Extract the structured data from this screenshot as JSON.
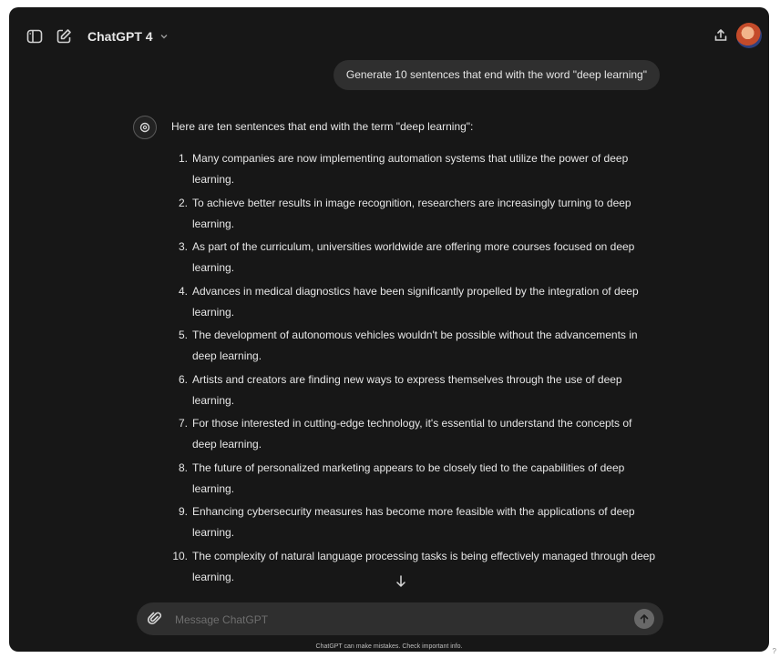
{
  "header": {
    "model_name": "ChatGPT 4",
    "icons": [
      "sidebar-toggle-icon",
      "new-chat-icon",
      "chevron-down-icon",
      "share-icon"
    ]
  },
  "conversation": {
    "user_message": "Generate 10 sentences that end with the word \"deep learning\"",
    "assistant_intro": "Here are ten sentences that end with the term \"deep learning\":",
    "sentences": [
      {
        "num": "1.",
        "line1": "Many companies are now implementing automation systems that utilize the power of deep",
        "line2": "learning."
      },
      {
        "num": "2.",
        "line1": "To achieve better results in image recognition, researchers are increasingly turning to deep",
        "line2": "learning."
      },
      {
        "num": "3.",
        "line1": "As part of the curriculum, universities worldwide are offering more courses focused on deep",
        "line2": "learning."
      },
      {
        "num": "4.",
        "line1": "Advances in medical diagnostics have been significantly propelled by the integration of deep",
        "line2": "learning."
      },
      {
        "num": "5.",
        "line1": "The development of autonomous vehicles wouldn't be possible without the advancements in",
        "line2": "deep learning."
      },
      {
        "num": "6.",
        "line1": "Artists and creators are finding new ways to express themselves through the use of deep",
        "line2": "learning."
      },
      {
        "num": "7.",
        "line1": "For those interested in cutting-edge technology, it's essential to understand the concepts of",
        "line2": "deep learning."
      },
      {
        "num": "8.",
        "line1": "The future of personalized marketing appears to be closely tied to the capabilities of deep",
        "line2": "learning."
      },
      {
        "num": "9.",
        "line1": "Enhancing cybersecurity measures has become more feasible with the applications of deep",
        "line2": "learning."
      },
      {
        "num": "10.",
        "line1": "The complexity of natural language processing tasks is being effectively managed through deep",
        "line2": "learning."
      }
    ]
  },
  "composer": {
    "placeholder": "Message ChatGPT",
    "value": ""
  },
  "footer": {
    "disclaimer": "ChatGPT can make mistakes. Check important info.",
    "help": "?"
  },
  "colors": {
    "background": "#171717",
    "bubble": "#2f2f2f",
    "text": "#ececec"
  }
}
